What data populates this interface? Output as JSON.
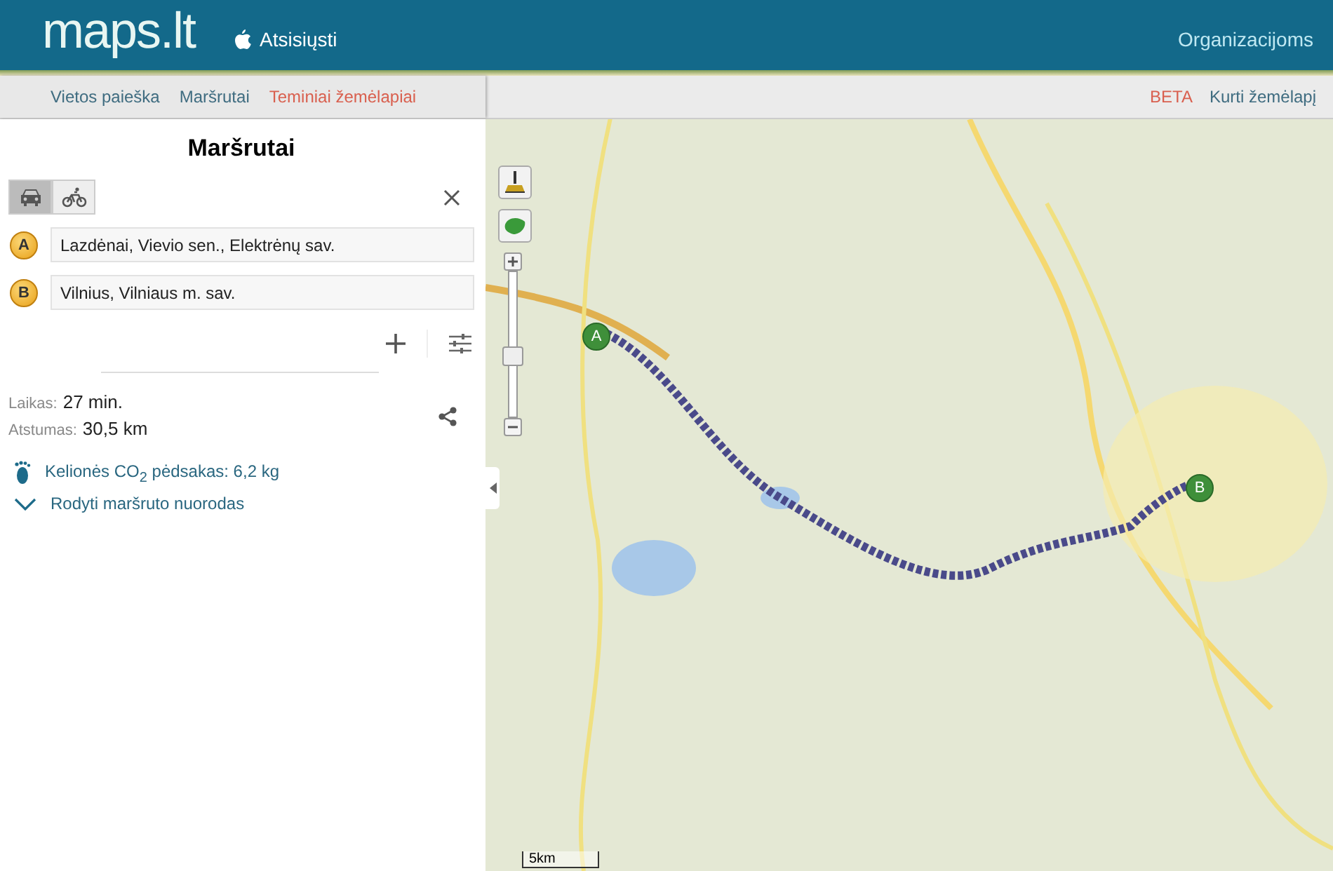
{
  "header": {
    "logo": "maps.lt",
    "download": "Atsisiųsti",
    "right_link": "Organizacijoms"
  },
  "nav": {
    "items": [
      {
        "label": "Vietos paieška",
        "highlighted": false
      },
      {
        "label": "Maršrutai",
        "highlighted": false
      },
      {
        "label": "Teminiai žemėlapiai",
        "highlighted": true
      }
    ],
    "badge": "BETA",
    "right_link": "Kurti žemėlapį"
  },
  "panel": {
    "title": "Maršrutai",
    "modes": [
      {
        "kind": "car",
        "selected": true
      },
      {
        "kind": "bike",
        "selected": false
      }
    ],
    "stops": [
      {
        "letter": "A",
        "value": "Lazdėnai, Vievio sen., Elektrėnų sav."
      },
      {
        "letter": "B",
        "value": "Vilnius, Vilniaus m. sav."
      }
    ],
    "summary": [
      {
        "label": "Laikas:",
        "value": "27 min."
      },
      {
        "label": "Atstumas:",
        "value": "30,5 km"
      }
    ],
    "footprint": "Kelionės CO$_{2}$ pėdsakas: 6,2 kg",
    "directions_link": "Rodyti maršruto nuorodas"
  },
  "map": {
    "markers": [
      {
        "letter": "A"
      },
      {
        "letter": "B"
      }
    ],
    "zoom": {
      "level": 0.43
    },
    "scale": "5km"
  }
}
